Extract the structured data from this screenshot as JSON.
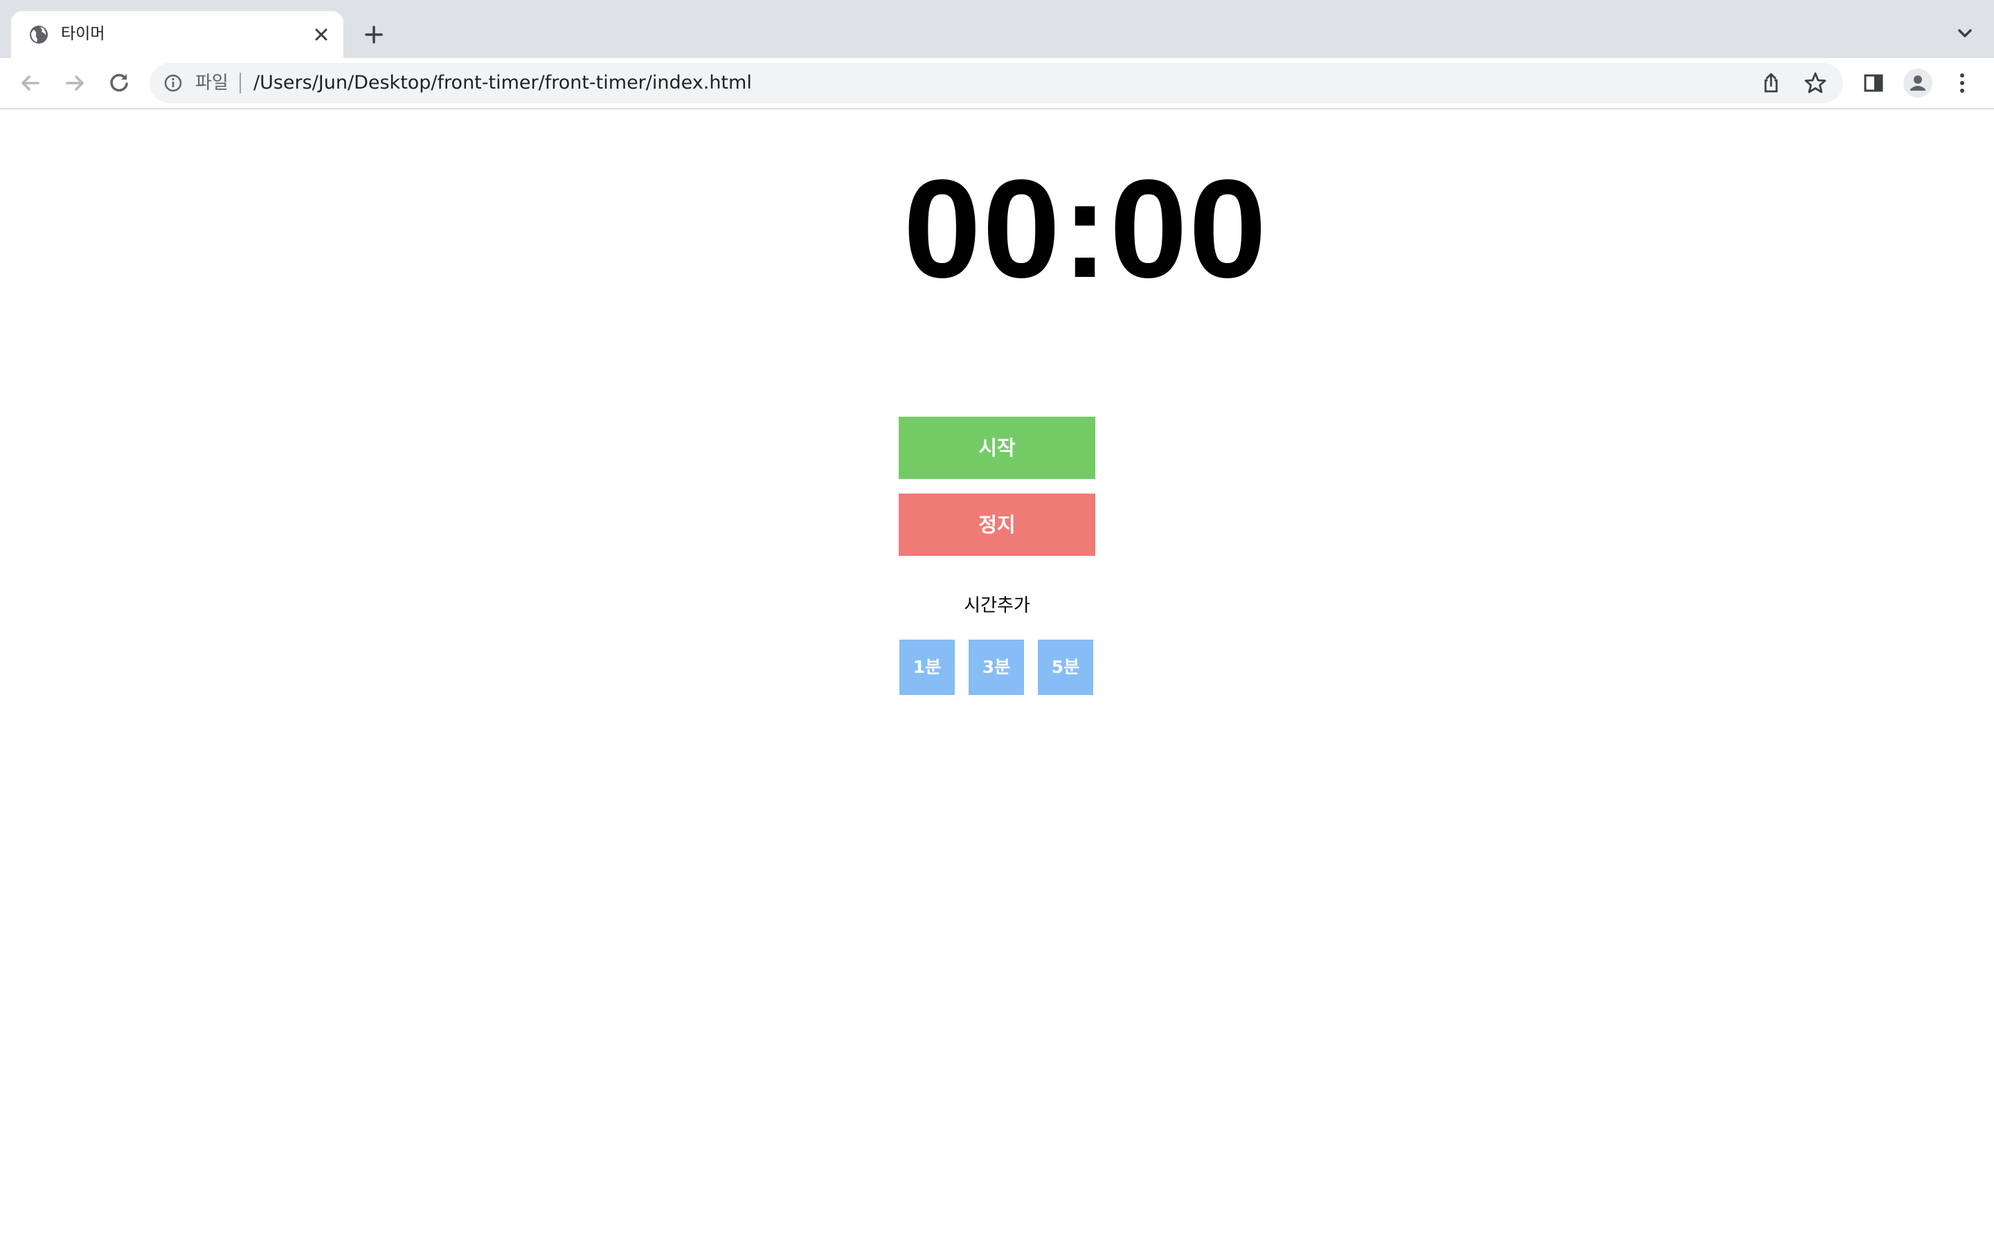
{
  "browser": {
    "tab": {
      "title": "타이머",
      "favicon": "globe-icon"
    },
    "omnibox": {
      "scheme_label": "파일",
      "url": "/Users/Jun/Desktop/front-timer/front-timer/index.html"
    },
    "icons": {
      "back": "arrow-left-icon",
      "forward": "arrow-right-icon",
      "reload": "reload-icon",
      "info": "info-icon",
      "share": "share-icon",
      "bookmark": "star-icon",
      "side_panel": "side-panel-icon",
      "profile": "profile-icon",
      "menu": "kebab-menu-icon",
      "new_tab": "plus-icon",
      "tab_search": "chevron-down-icon",
      "close_tab": "close-icon"
    }
  },
  "timer": {
    "display": "00:00",
    "start_label": "시작",
    "stop_label": "정지",
    "add_time_label": "시간추가",
    "add_buttons": [
      "1분",
      "3분",
      "5분"
    ]
  },
  "colors": {
    "start": "#74cb66",
    "stop": "#ef7b77",
    "add_time": "#86bdf5",
    "tabstrip": "#dee1e6",
    "omnibox": "#f1f3f4"
  }
}
